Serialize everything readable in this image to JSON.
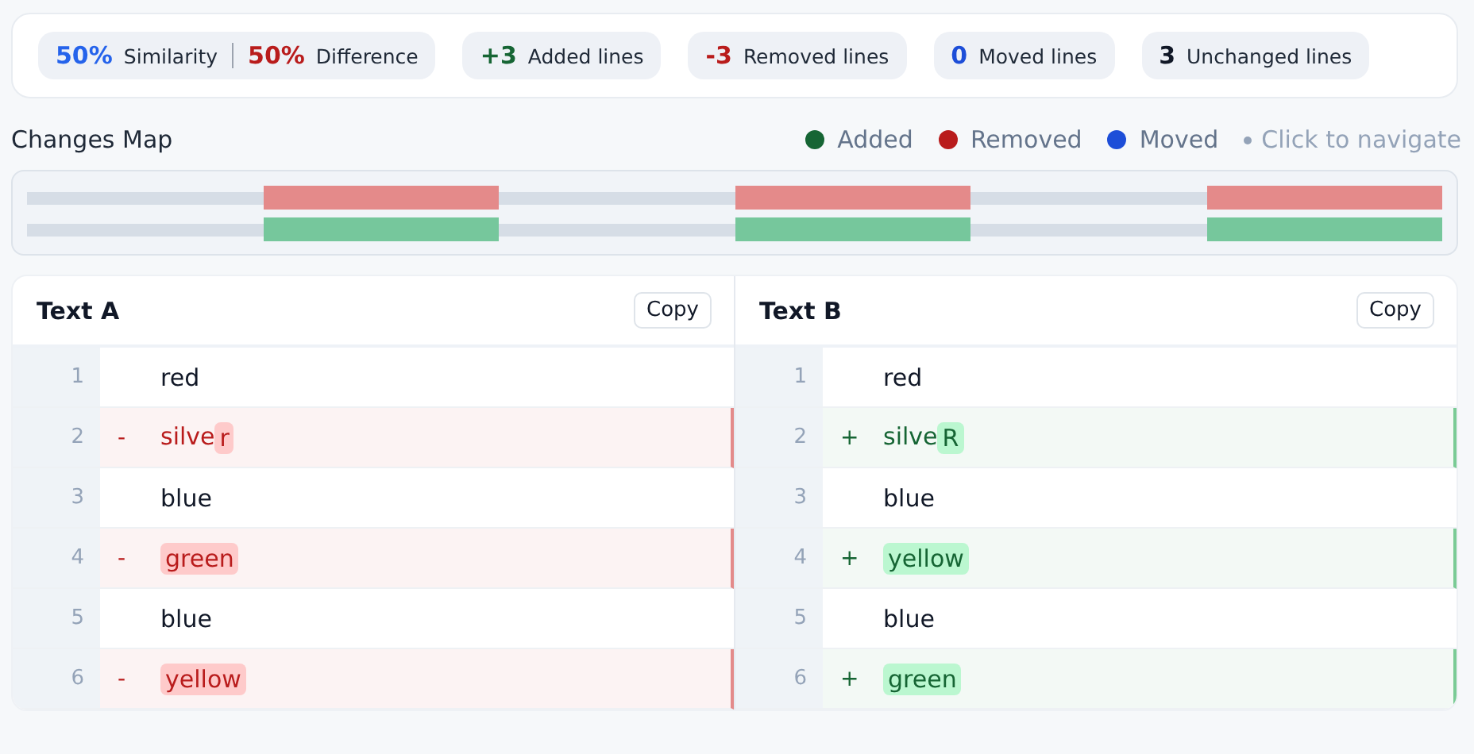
{
  "summary": {
    "similarity": {
      "value": "50%",
      "label": "Similarity"
    },
    "difference": {
      "value": "50%",
      "label": "Difference"
    }
  },
  "stats": [
    {
      "kind": "added",
      "value": "+3",
      "label": "Added lines"
    },
    {
      "kind": "removed",
      "value": "-3",
      "label": "Removed lines"
    },
    {
      "kind": "moved",
      "value": "0",
      "label": "Moved lines"
    },
    {
      "kind": "unchanged",
      "value": "3",
      "label": "Unchanged lines"
    }
  ],
  "changes_map": {
    "title": "Changes Map",
    "legend": [
      {
        "label": "Added",
        "color": "#166534"
      },
      {
        "label": "Removed",
        "color": "#b91c1c"
      },
      {
        "label": "Moved",
        "color": "#1d4ed8"
      }
    ],
    "hint": "Click to navigate",
    "tracks": [
      {
        "segments": [
          {
            "kind": "unchanged"
          },
          {
            "kind": "removed"
          },
          {
            "kind": "unchanged"
          },
          {
            "kind": "removed"
          },
          {
            "kind": "unchanged"
          },
          {
            "kind": "removed"
          }
        ]
      },
      {
        "segments": [
          {
            "kind": "unchanged"
          },
          {
            "kind": "added"
          },
          {
            "kind": "unchanged"
          },
          {
            "kind": "added"
          },
          {
            "kind": "unchanged"
          },
          {
            "kind": "added"
          }
        ]
      }
    ]
  },
  "panels": [
    {
      "title": "Text A",
      "copy_label": "Copy",
      "lines": [
        {
          "number": "1",
          "kind": "unchanged",
          "parts": [
            {
              "text": "red",
              "highlight": false
            }
          ]
        },
        {
          "number": "2",
          "kind": "removed",
          "marker": "-",
          "parts": [
            {
              "text": "silve",
              "highlight": false
            },
            {
              "text": "r",
              "highlight": true
            }
          ]
        },
        {
          "number": "3",
          "kind": "unchanged",
          "parts": [
            {
              "text": "blue",
              "highlight": false
            }
          ]
        },
        {
          "number": "4",
          "kind": "removed",
          "marker": "-",
          "parts": [
            {
              "text": "green",
              "highlight": true
            }
          ]
        },
        {
          "number": "5",
          "kind": "unchanged",
          "parts": [
            {
              "text": "blue",
              "highlight": false
            }
          ]
        },
        {
          "number": "6",
          "kind": "removed",
          "marker": "-",
          "parts": [
            {
              "text": "yellow",
              "highlight": true
            }
          ]
        }
      ]
    },
    {
      "title": "Text B",
      "copy_label": "Copy",
      "lines": [
        {
          "number": "1",
          "kind": "unchanged",
          "parts": [
            {
              "text": "red",
              "highlight": false
            }
          ]
        },
        {
          "number": "2",
          "kind": "added",
          "marker": "+",
          "parts": [
            {
              "text": "silve",
              "highlight": false
            },
            {
              "text": "R",
              "highlight": true
            }
          ]
        },
        {
          "number": "3",
          "kind": "unchanged",
          "parts": [
            {
              "text": "blue",
              "highlight": false
            }
          ]
        },
        {
          "number": "4",
          "kind": "added",
          "marker": "+",
          "parts": [
            {
              "text": "yellow",
              "highlight": true
            }
          ]
        },
        {
          "number": "5",
          "kind": "unchanged",
          "parts": [
            {
              "text": "blue",
              "highlight": false
            }
          ]
        },
        {
          "number": "6",
          "kind": "added",
          "marker": "+",
          "parts": [
            {
              "text": "green",
              "highlight": true
            }
          ]
        }
      ]
    }
  ]
}
